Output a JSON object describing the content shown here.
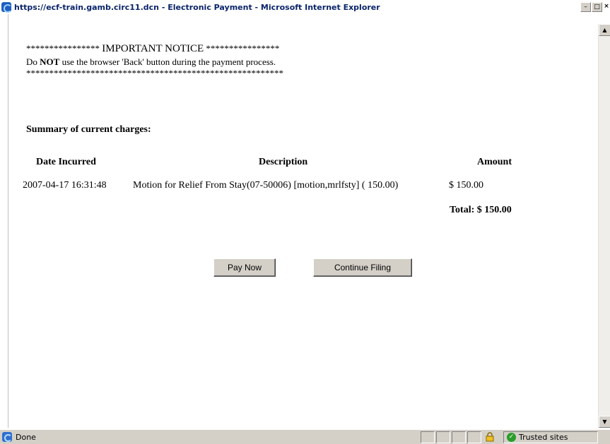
{
  "window": {
    "title": "https://ecf-train.gamb.circ11.dcn - Electronic Payment - Microsoft Internet Explorer",
    "controls": [
      "–",
      "□",
      "×"
    ]
  },
  "notice": {
    "stars_left": "****************",
    "heading": "IMPORTANT NOTICE",
    "stars_right": "****************",
    "text_prefix": "Do ",
    "text_bold": "NOT",
    "text_suffix": " use the browser 'Back' button during the payment process.",
    "stars_line": "********************************************************"
  },
  "summary_title": "Summary of current charges:",
  "table": {
    "headers": {
      "date": "Date Incurred",
      "description": "Description",
      "amount": "Amount"
    },
    "rows": [
      {
        "date": "2007-04-17 16:31:48",
        "description": "Motion for Relief From Stay(07-50006) [motion,mrlfsty] ( 150.00)",
        "amount": "$ 150.00"
      }
    ],
    "total": "Total: $ 150.00"
  },
  "buttons": {
    "pay_now": "Pay Now",
    "continue_filing": "Continue Filing"
  },
  "statusbar": {
    "status": "Done",
    "zone": "Trusted sites"
  },
  "icons": {
    "app": "ie-icon",
    "status": "ie-page-icon",
    "lock": "lock-icon",
    "zone": "trusted-sites-check-icon"
  }
}
